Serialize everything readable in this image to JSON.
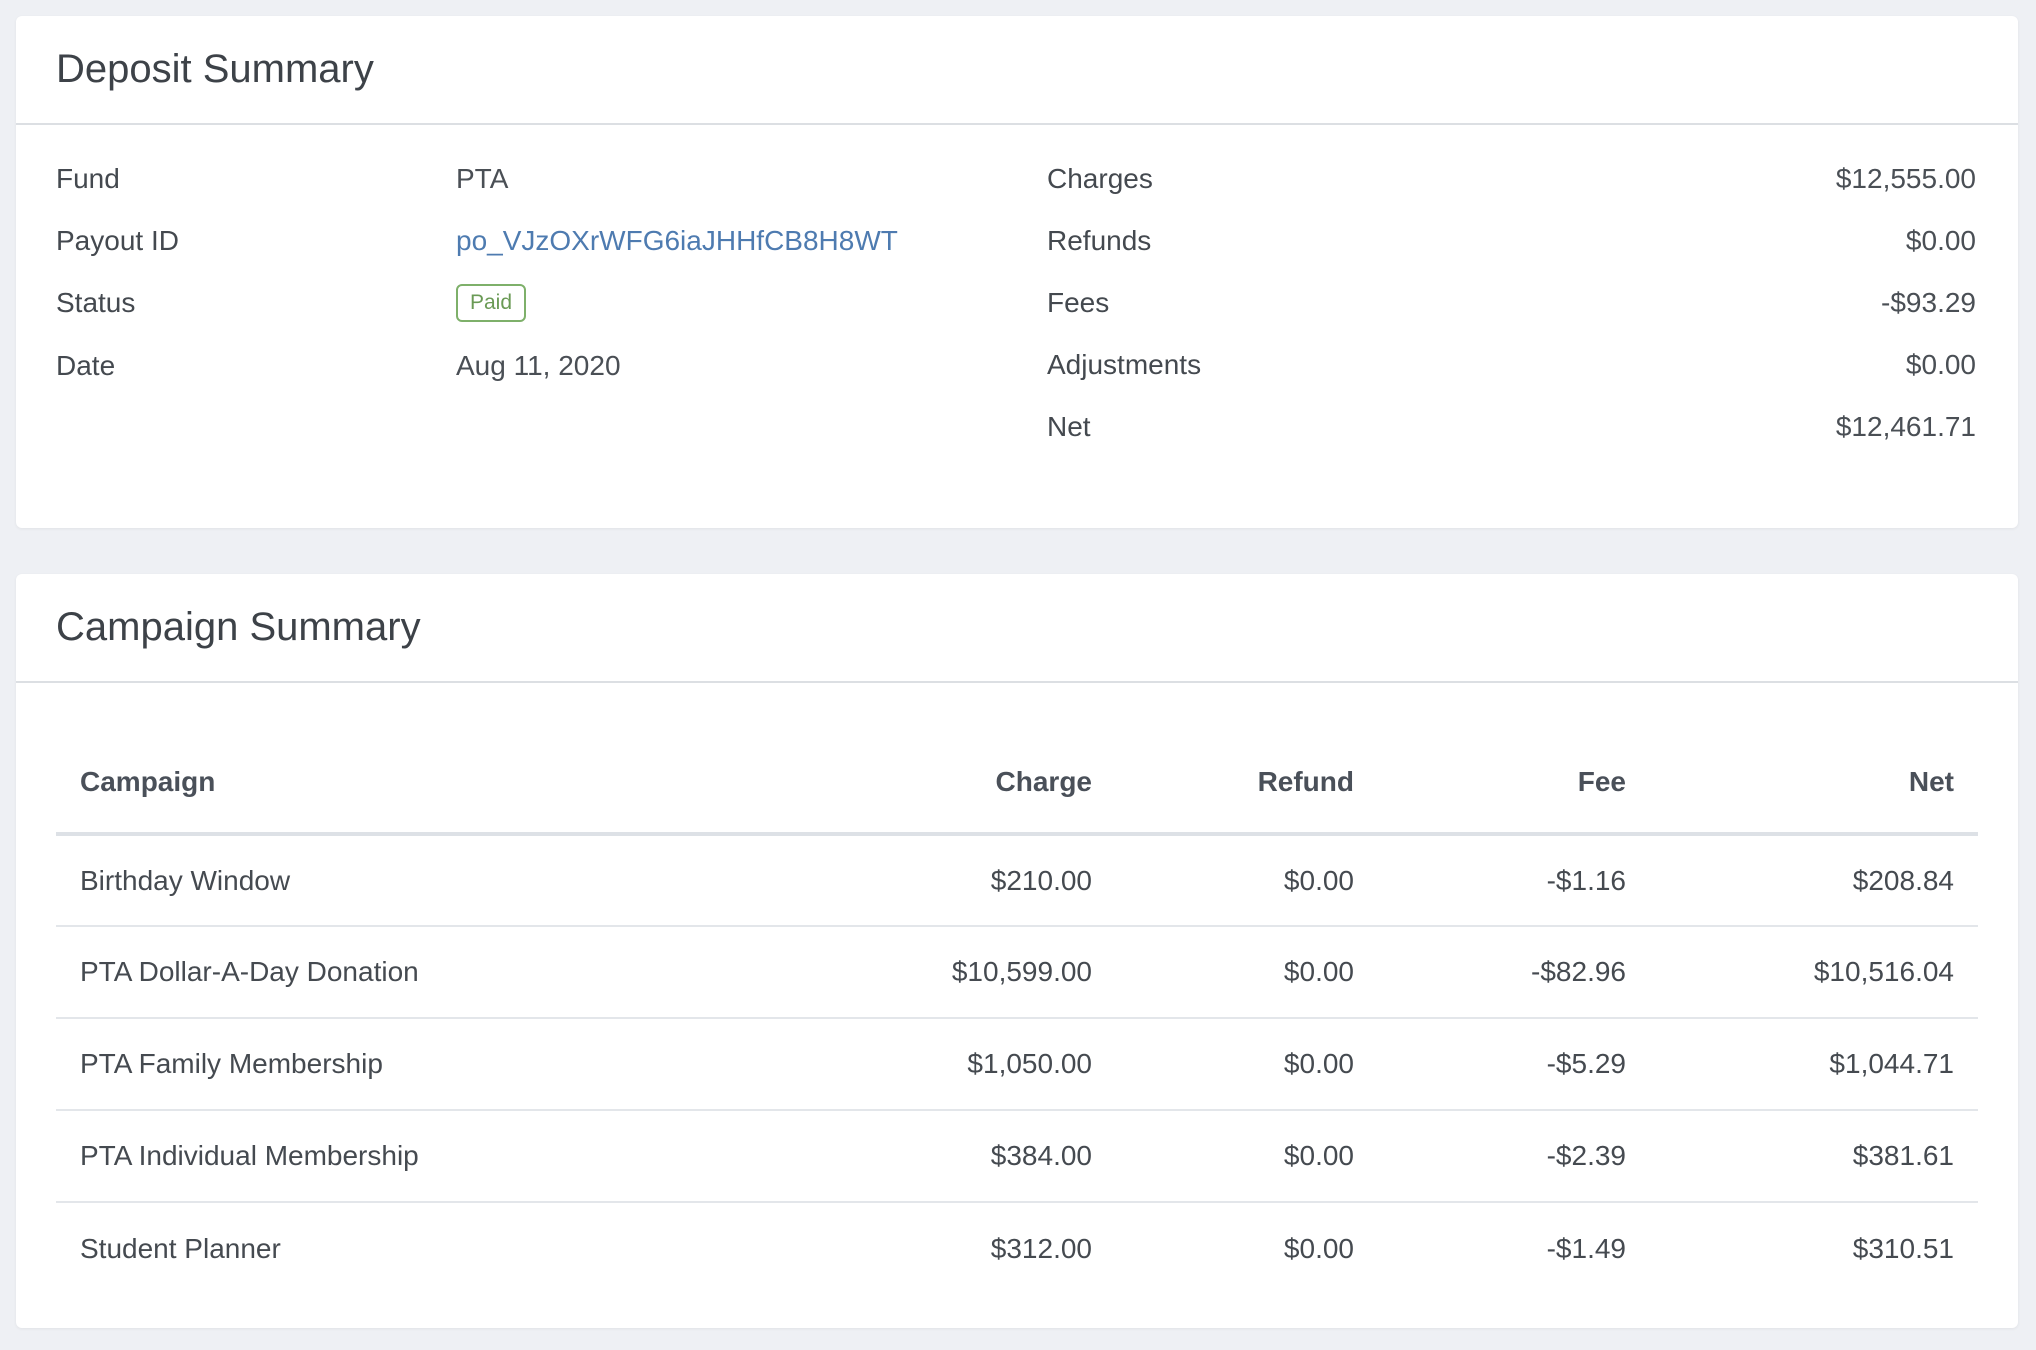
{
  "deposit_summary": {
    "title": "Deposit Summary",
    "fund_label": "Fund",
    "fund_value": "PTA",
    "payout_label": "Payout ID",
    "payout_value": "po_VJzOXrWFG6iaJHHfCB8H8WT",
    "status_label": "Status",
    "status_value": "Paid",
    "date_label": "Date",
    "date_value": "Aug 11, 2020",
    "charges_label": "Charges",
    "charges_value": "$12,555.00",
    "refunds_label": "Refunds",
    "refunds_value": "$0.00",
    "fees_label": "Fees",
    "fees_value": "-$93.29",
    "adjustments_label": "Adjustments",
    "adjustments_value": "$0.00",
    "net_label": "Net",
    "net_value": "$12,461.71"
  },
  "campaign_summary": {
    "title": "Campaign Summary",
    "columns": [
      "Campaign",
      "Charge",
      "Refund",
      "Fee",
      "Net"
    ],
    "rows": [
      [
        "Birthday Window",
        "$210.00",
        "$0.00",
        "-$1.16",
        "$208.84"
      ],
      [
        "PTA Dollar-A-Day Donation",
        "$10,599.00",
        "$0.00",
        "-$82.96",
        "$10,516.04"
      ],
      [
        "PTA Family Membership",
        "$1,050.00",
        "$0.00",
        "-$5.29",
        "$1,044.71"
      ],
      [
        "PTA Individual Membership",
        "$384.00",
        "$0.00",
        "-$2.39",
        "$381.61"
      ],
      [
        "Student Planner",
        "$312.00",
        "$0.00",
        "-$1.49",
        "$310.51"
      ]
    ]
  },
  "colors": {
    "background": "#eef0f4",
    "link": "#4e7bb0",
    "status_paid": "#6a9a55"
  }
}
